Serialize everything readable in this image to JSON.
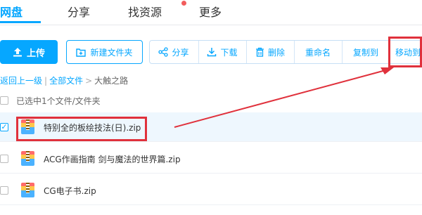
{
  "nav": {
    "tabs": [
      {
        "label": "网盘"
      },
      {
        "label": "分享"
      },
      {
        "label": "找资源"
      },
      {
        "label": "更多"
      }
    ]
  },
  "toolbar": {
    "upload": "上传",
    "new_folder": "新建文件夹",
    "share": "分享",
    "download": "下载",
    "delete": "删除",
    "rename": "重命名",
    "copy_to": "复制到",
    "move_to": "移动到"
  },
  "breadcrumb": {
    "back": "返回上一级",
    "all_files": "全部文件",
    "current": "大触之路"
  },
  "selection": {
    "text": "已选中1个文件/文件夹"
  },
  "files": [
    {
      "name": "特别全的板绘技法(日).zip",
      "checked": true
    },
    {
      "name": "ACG作画指南 剑与魔法的世界篇.zip",
      "checked": false
    },
    {
      "name": "CG电子书.zip",
      "checked": false
    }
  ],
  "colors": {
    "accent": "#06a7ff",
    "annotation": "#e0313c"
  }
}
